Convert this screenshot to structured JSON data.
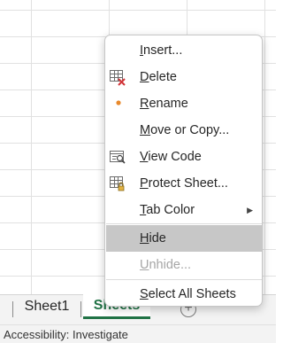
{
  "sheets": {
    "tabs": [
      {
        "label": "Sheet1",
        "active": false
      },
      {
        "label": "Sheets",
        "active": true
      }
    ],
    "add_sheet_icon": "plus-circle-icon"
  },
  "status_bar": {
    "accessibility": "Accessibility: Investigate"
  },
  "context_menu": {
    "items": [
      {
        "mnemonic": "I",
        "rest": "nsert...",
        "icon": null,
        "enabled": true
      },
      {
        "mnemonic": "D",
        "rest": "elete",
        "icon": "delete-sheet-icon",
        "enabled": true
      },
      {
        "mnemonic": "R",
        "rest": "ename",
        "icon": "rename-dot-icon",
        "enabled": true
      },
      {
        "mnemonic": "M",
        "rest": "ove or Copy...",
        "icon": null,
        "enabled": true
      },
      {
        "mnemonic": "V",
        "rest": "iew Code",
        "icon": "view-code-icon",
        "enabled": true
      },
      {
        "mnemonic": "P",
        "rest": "rotect Sheet...",
        "icon": "protect-sheet-icon",
        "enabled": true
      },
      {
        "mnemonic": "T",
        "rest": "ab Color",
        "icon": null,
        "enabled": true,
        "submenu": true
      },
      {
        "mnemonic": "H",
        "rest": "ide",
        "icon": null,
        "enabled": true,
        "highlighted": true
      },
      {
        "mnemonic": "U",
        "rest": "nhide...",
        "icon": null,
        "enabled": false
      },
      {
        "mnemonic": "S",
        "rest": "elect All Sheets",
        "icon": null,
        "enabled": true
      }
    ]
  },
  "colors": {
    "accent": "#217346",
    "highlight": "#c7c7c7",
    "rename_dot": "#e8892b",
    "delete_x": "#d13438"
  }
}
